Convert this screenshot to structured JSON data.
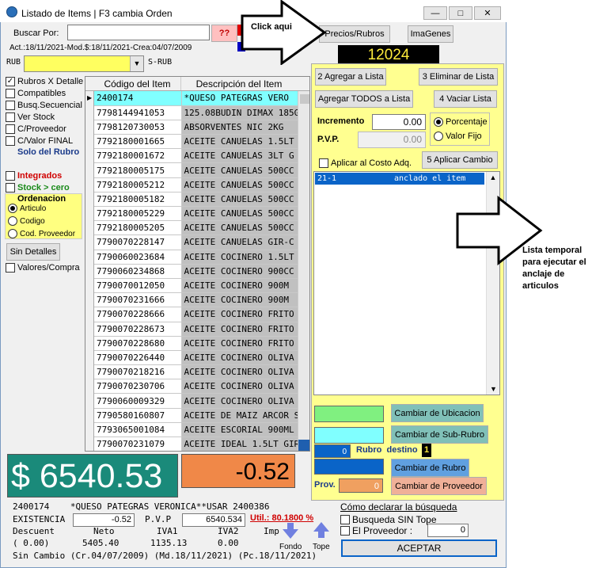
{
  "window": {
    "title": "Listado de Items | F3 cambia Orden"
  },
  "search": {
    "label": "Buscar Por:",
    "value": "",
    "qq_button": "??",
    "info": "Act.:18/11/2021-Mod.$:18/11/2021-Crea:04/07/2009"
  },
  "rub": {
    "label": "RUB",
    "srub_label": "S-RUB"
  },
  "top_buttons": {
    "precios": "Precios/Rubros",
    "imagenes": "ImaGenes",
    "counter": "12024"
  },
  "annotations": {
    "click": "Click aqui",
    "lista": "Lista temporal para ejecutar el anclaje de articulos"
  },
  "options": [
    {
      "label": "Rubros X Detalle",
      "checked": true,
      "color": "#000"
    },
    {
      "label": "Compatibles",
      "checked": false,
      "color": "#000"
    },
    {
      "label": "Busq.Secuencial",
      "checked": false,
      "color": "#000"
    },
    {
      "label": "Ver Stock",
      "checked": false,
      "color": "#000"
    },
    {
      "label": "C/Proveedor",
      "checked": false,
      "color": "#000"
    },
    {
      "label": "C/Valor FINAL",
      "checked": false,
      "color": "#000"
    }
  ],
  "solo_rubro": "Solo del Rubro",
  "integrados": "Integrados",
  "stock_cero": "Stock > cero",
  "ordenacion": {
    "title": "Ordenacion",
    "options": [
      "Articulo",
      "Codigo",
      "Cod. Proveedor"
    ],
    "selected": 0
  },
  "sin_detalles": "Sin Detalles",
  "valores_compra": "Valores/Compra",
  "table": {
    "headers": [
      "Código del Item",
      "Descripción del Item"
    ],
    "rows": [
      [
        "2400174",
        "*QUESO PATEGRAS VERO"
      ],
      [
        "7798144941053",
        "125.08BUDIN DIMAX 185G"
      ],
      [
        "7798120730053",
        "ABSORVENTES NIC 2KG"
      ],
      [
        "7792180001665",
        "ACEITE CANUELAS 1.5LT"
      ],
      [
        "7792180001672",
        "ACEITE CANUELAS 3LT G"
      ],
      [
        "7792180005175",
        "ACEITE CANUELAS 500CC"
      ],
      [
        "7792180005212",
        "ACEITE CANUELAS 500CC"
      ],
      [
        "7792180005182",
        "ACEITE CANUELAS 500CC"
      ],
      [
        "7792180005229",
        "ACEITE CANUELAS 500CC"
      ],
      [
        "7792180005205",
        "ACEITE CANUELAS 500CC"
      ],
      [
        "7790070228147",
        "ACEITE CANUELAS GIR-C"
      ],
      [
        "7790060023684",
        "ACEITE COCINERO 1.5LT"
      ],
      [
        "7790060234868",
        "ACEITE COCINERO 900CC"
      ],
      [
        "7790070012050",
        "ACEITE COCINERO 900M"
      ],
      [
        "7790070231666",
        "ACEITE COCINERO 900M"
      ],
      [
        "7790070228666",
        "ACEITE COCINERO FRITO"
      ],
      [
        "7790070228673",
        "ACEITE COCINERO FRITO"
      ],
      [
        "7790070228680",
        "ACEITE COCINERO FRITO"
      ],
      [
        "7790070226440",
        "ACEITE COCINERO OLIVA"
      ],
      [
        "7790070218216",
        "ACEITE COCINERO OLIVA"
      ],
      [
        "7790070230706",
        "ACEITE COCINERO OLIVA"
      ],
      [
        "7790060009329",
        "ACEITE COCINERO OLIVA"
      ],
      [
        "7790580160807",
        "ACEITE DE MAIZ ARCOR S"
      ],
      [
        "7793065001084",
        "ACEITE ESCORIAL 900ML"
      ],
      [
        "7790070231079",
        "ACEITE IDEAL 1.5LT GIR"
      ]
    ]
  },
  "right": {
    "agregar": "2 Agregar a Lista",
    "eliminar": "3 Eliminar de Lista",
    "agregar_todos": "Agregar TODOS a Lista",
    "vaciar": "4 Vaciar Lista",
    "incremento_label": "Incremento",
    "incremento_value": "0.00",
    "pvp_label": "P.V.P.",
    "pvp_value": "0.00",
    "porcentaje": "Porcentaje",
    "valor_fijo": "Valor Fijo",
    "aplicar_costo": "Aplicar al Costo Adq.",
    "aplicar_cambio": "5 Aplicar Cambio",
    "list_item_code": "21-1",
    "list_item_text": "anclado el item",
    "cambiar_ubicacion": "Cambiar de Ubicacion",
    "cambiar_subrubro": "Cambiar de Sub-Rubro",
    "rubro_num": "0",
    "rubro_destino": "Rubro  destino",
    "rubro_destino_val": "1",
    "cambiar_rubro": "Cambiar de Rubro",
    "prov_label": "Prov.",
    "prov_value": "0",
    "cambiar_proveedor": "Cambiar de Proveedor"
  },
  "bottom": {
    "price": "$ 6540.53",
    "diff": "-0.52",
    "item_line": "2400174    *QUESO PATEGRAS VERONICA**USAR 2400386",
    "existencia_label": "EXISTENCIA",
    "existencia_value": "-0.52",
    "pvp_label": "P.V.P",
    "pvp_value": "6540.534",
    "util": "Util.: 80.1800 %",
    "descuent": "Descuent",
    "neto": "Neto",
    "iva1": "IVA1",
    "iva2": "IVA2",
    "imp": "Imp",
    "desc_val": "( 0.00)",
    "neto_val": "5405.40",
    "iva1_val": "1135.13",
    "iva2_val": "0.00",
    "sin_cambio": "Sin Cambio (Cr.04/07/2009) (Md.18/11/2021) (Pc.18/11/2021)",
    "fondo": "Fondo",
    "tope": "Tope",
    "como_declarar": "Cómo declarar la búsqueda",
    "busqueda_sin_tope": "Busqueda SIN Tope",
    "el_proveedor": "El Proveedor :",
    "proveedor_val": "0",
    "aceptar": "ACEPTAR"
  }
}
